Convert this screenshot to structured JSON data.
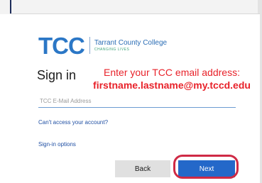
{
  "logo": {
    "mark": "TCC",
    "name": "Tarrant County College",
    "tagline": "CHANGING LIVES"
  },
  "signin": {
    "heading": "Sign in",
    "email_placeholder": "TCC E-Mail Address",
    "email_value": "",
    "cant_access_link": "Can't access your account?",
    "signin_options_link": "Sign-in options"
  },
  "buttons": {
    "back": "Back",
    "next": "Next"
  },
  "annotation": {
    "line1": "Enter your TCC email address:",
    "line2": "firstname.lastname@my.tccd.edu",
    "color": "#e8222a"
  },
  "colors": {
    "brand_blue": "#2b77c6",
    "primary_button": "#2468c9",
    "highlight_circle": "#cf2a45"
  }
}
